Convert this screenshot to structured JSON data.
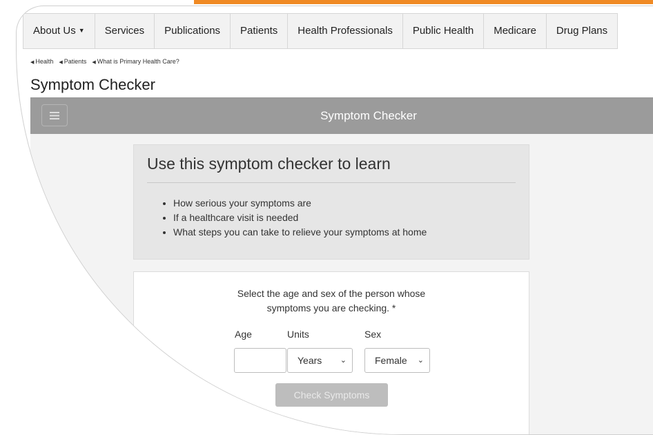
{
  "nav": {
    "items": [
      {
        "label": "About Us",
        "has_caret": true
      },
      {
        "label": "Services"
      },
      {
        "label": "Publications"
      },
      {
        "label": "Patients"
      },
      {
        "label": "Health Professionals"
      },
      {
        "label": "Public Health"
      },
      {
        "label": "Medicare"
      },
      {
        "label": "Drug Plans"
      }
    ]
  },
  "breadcrumb": [
    "Health",
    "Patients",
    "What is Primary Health Care?"
  ],
  "page_title": "Symptom Checker",
  "widget": {
    "title": "Symptom Checker",
    "info": {
      "heading": "Use this symptom checker to learn",
      "bullets": [
        "How serious your symptoms are",
        "If a healthcare visit is needed",
        "What steps you can take to relieve your symptoms at home"
      ]
    },
    "form": {
      "prompt_line1": "Select the age and sex of the person whose",
      "prompt_line2": "symptoms you are checking. *",
      "age_label": "Age",
      "age_value": "",
      "units_label": "Units",
      "units_selected": "Years",
      "sex_label": "Sex",
      "sex_selected": "Female",
      "check_button": "Check Symptoms"
    }
  },
  "colors": {
    "accent_orange": "#f08a24",
    "header_gray": "#9b9b9b"
  }
}
